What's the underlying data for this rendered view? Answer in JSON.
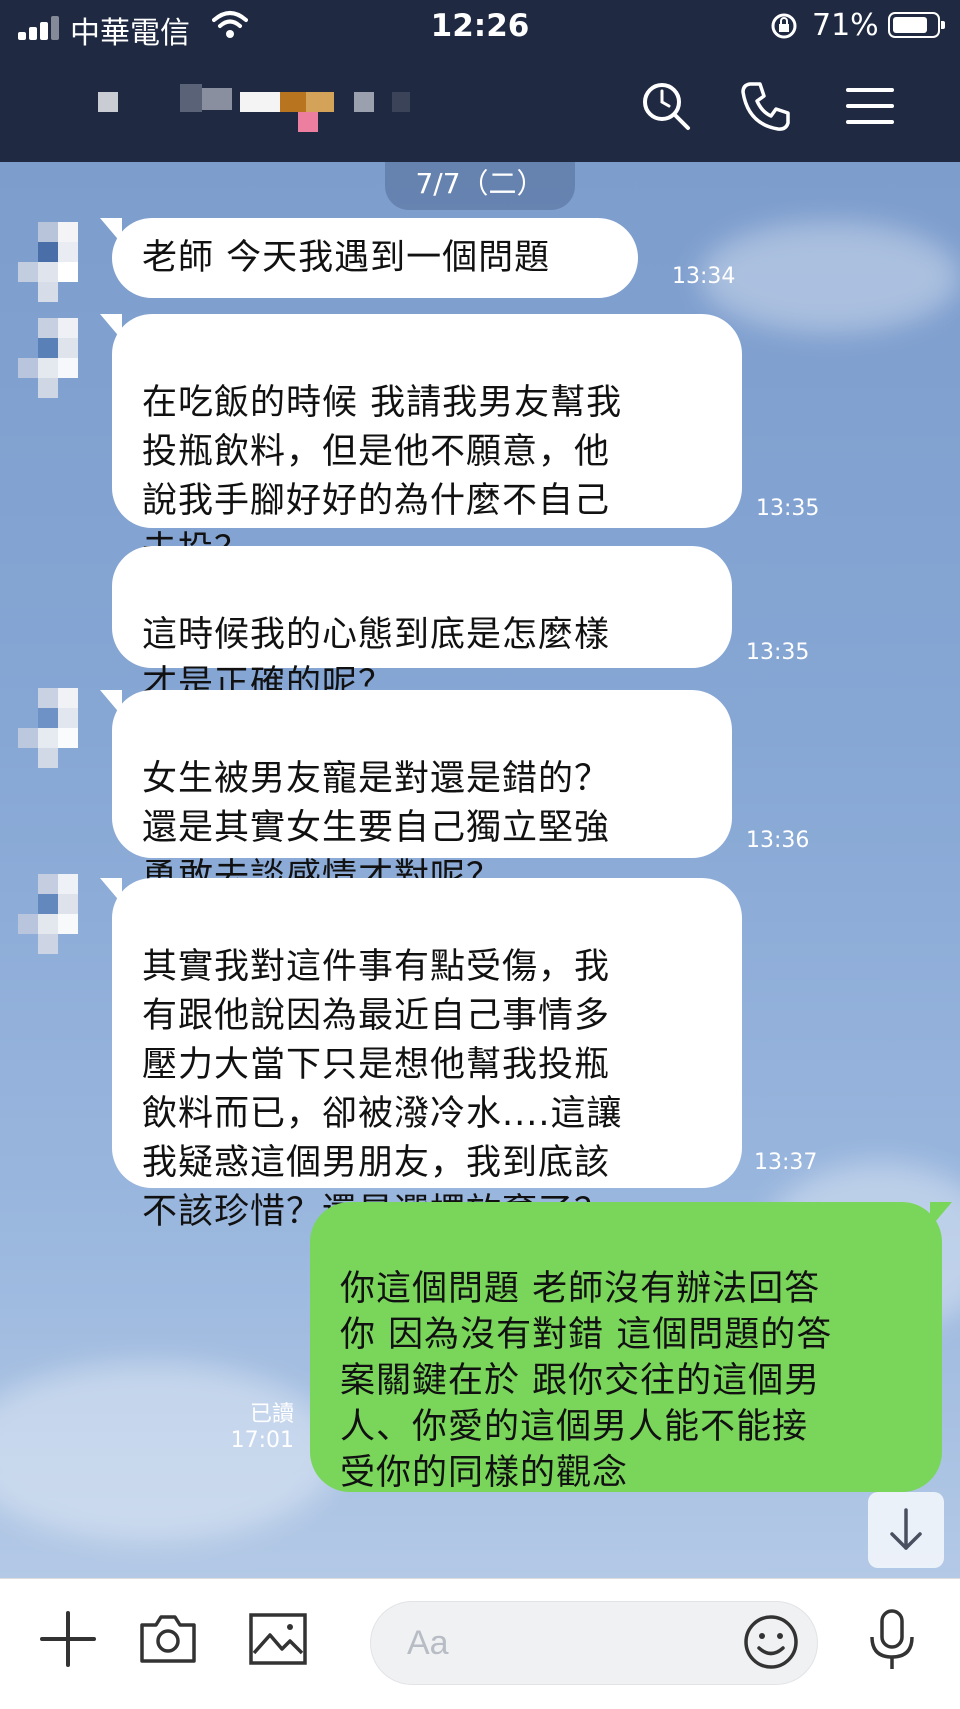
{
  "status_bar": {
    "carrier": "中華電信",
    "time": "12:26",
    "battery_percent": "71%",
    "battery_level": 0.71
  },
  "header": {
    "icons": [
      "search-icon",
      "phone-icon",
      "menu-icon"
    ]
  },
  "chat": {
    "date_label": "7/7（二）",
    "messages": [
      {
        "text": "老師 今天我遇到一個問題",
        "time": "13:34"
      },
      {
        "text": "在吃飯的時候 我請我男友幫我\n投瓶飲料，但是他不願意，他\n說我手腳好好的為什麼不自己\n去投？",
        "time": "13:35"
      },
      {
        "text": "這時候我的心態到底是怎麼樣\n才是正確的呢？",
        "time": "13:35"
      },
      {
        "text": "女生被男友寵是對還是錯的？\n還是其實女生要自己獨立堅強\n勇敢去談感情才對呢？",
        "time": "13:36"
      },
      {
        "text": "其實我對這件事有點受傷，我\n有跟他說因為最近自己事情多\n壓力大當下只是想他幫我投瓶\n飲料而已，卻被潑冷水....這讓\n我疑惑這個男朋友，我到底該\n不該珍惜？還是選擇放棄了？",
        "time": "13:37"
      }
    ],
    "outgoing": {
      "text": "你這個問題 老師沒有辦法回答\n你 因為沒有對錯 這個問題的答\n案關鍵在於 跟你交往的這個男\n人、你愛的這個男人能不能接\n受你的同樣的觀念",
      "read_label": "已讀",
      "time": "17:01"
    }
  },
  "input_bar": {
    "placeholder": "Aa",
    "icons": [
      "plus-icon",
      "camera-icon",
      "image-icon",
      "emoji-icon",
      "microphone-icon"
    ]
  },
  "colors": {
    "header_bg": "#1f2a42",
    "outgoing_bubble": "#79d65b",
    "incoming_bubble": "#ffffff",
    "chat_bg": "#7f9fce"
  }
}
